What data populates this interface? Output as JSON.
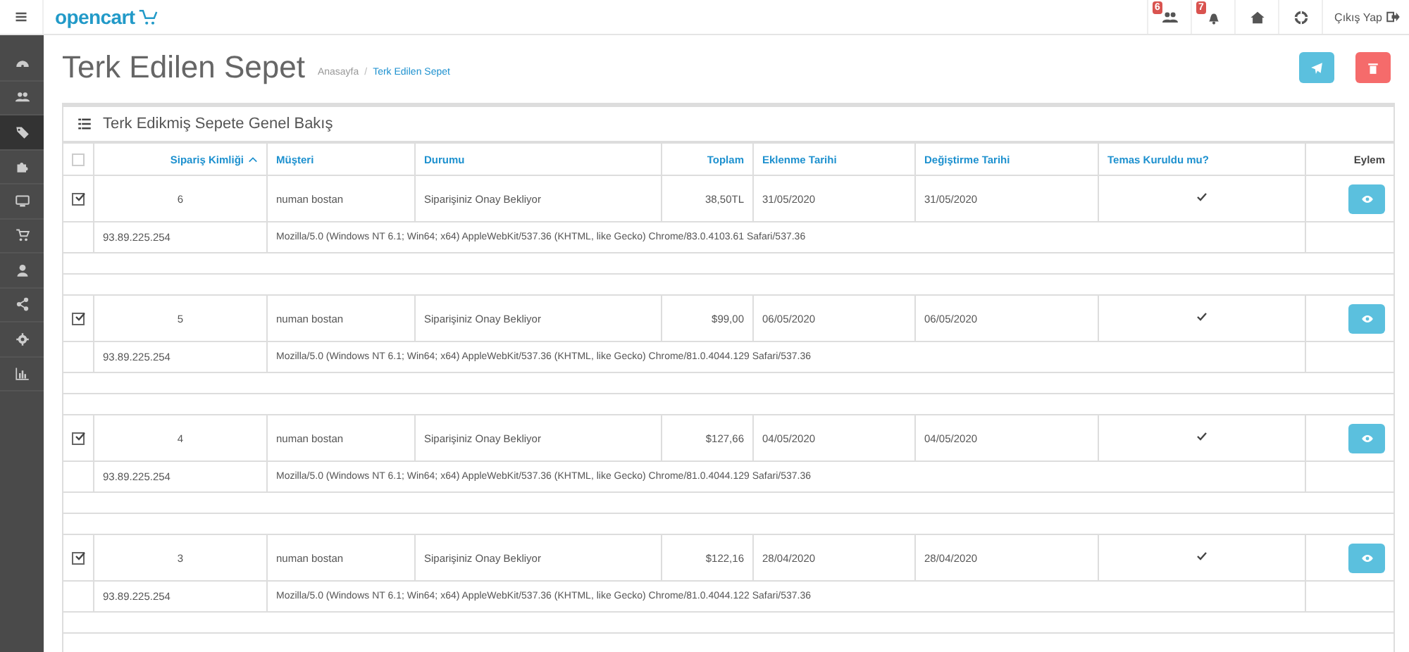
{
  "header": {
    "logo": "opencart",
    "notifications": [
      {
        "kind": "users",
        "count": "6"
      },
      {
        "kind": "bell",
        "count": "7"
      },
      {
        "kind": "home"
      },
      {
        "kind": "help"
      }
    ],
    "logout": "Çıkış Yap"
  },
  "sidebar": {
    "items": [
      {
        "selected": false
      },
      {
        "selected": false
      },
      {
        "selected": true
      },
      {
        "selected": false
      },
      {
        "selected": false
      },
      {
        "selected": false
      },
      {
        "selected": false
      },
      {
        "selected": false
      },
      {
        "selected": false
      },
      {
        "selected": false
      }
    ]
  },
  "page": {
    "title": "Terk Edilen Sepet",
    "breadcrumb_separator": "/",
    "breadcrumbs": [
      {
        "label": "Anasayfa",
        "selected": false
      },
      {
        "label": "Terk Edilen Sepet",
        "selected": true
      }
    ]
  },
  "panel": {
    "title": "Terk Edikmiş Sepete Genel Bakış"
  },
  "table": {
    "select_all": false,
    "columns": [
      {
        "label": "Sipariş Kimliği",
        "sorted": true
      },
      {
        "label": "Müşteri",
        "sorted": false
      },
      {
        "label": "Durumu",
        "sorted": false
      },
      {
        "label": "Toplam",
        "sorted": false
      },
      {
        "label": "Eklenme Tarihi",
        "sorted": false
      },
      {
        "label": "Değiştirme Tarihi",
        "sorted": false
      },
      {
        "label": "Temas Kuruldu mu?",
        "sorted": false
      },
      {
        "label": "Eylem",
        "sorted": false
      }
    ],
    "rows": [
      {
        "checked": true,
        "id": "6",
        "customer": "numan bostan",
        "status": "Siparişiniz Onay Bekliyor",
        "total": "38,50TL",
        "date_added": "31/05/2020",
        "date_modified": "31/05/2020",
        "contacted": true,
        "ip": "93.89.225.254",
        "user_agent": "Mozilla/5.0 (Windows NT 6.1; Win64; x64) AppleWebKit/537.36 (KHTML, like Gecko) Chrome/83.0.4103.61 Safari/537.36"
      },
      {
        "checked": true,
        "id": "5",
        "customer": "numan bostan",
        "status": "Siparişiniz Onay Bekliyor",
        "total": "$99,00",
        "date_added": "06/05/2020",
        "date_modified": "06/05/2020",
        "contacted": true,
        "ip": "93.89.225.254",
        "user_agent": "Mozilla/5.0 (Windows NT 6.1; Win64; x64) AppleWebKit/537.36 (KHTML, like Gecko) Chrome/81.0.4044.129 Safari/537.36"
      },
      {
        "checked": true,
        "id": "4",
        "customer": "numan bostan",
        "status": "Siparişiniz Onay Bekliyor",
        "total": "$127,66",
        "date_added": "04/05/2020",
        "date_modified": "04/05/2020",
        "contacted": true,
        "ip": "93.89.225.254",
        "user_agent": "Mozilla/5.0 (Windows NT 6.1; Win64; x64) AppleWebKit/537.36 (KHTML, like Gecko) Chrome/81.0.4044.129 Safari/537.36"
      },
      {
        "checked": true,
        "id": "3",
        "customer": "numan bostan",
        "status": "Siparişiniz Onay Bekliyor",
        "total": "$122,16",
        "date_added": "28/04/2020",
        "date_modified": "28/04/2020",
        "contacted": true,
        "ip": "93.89.225.254",
        "user_agent": "Mozilla/5.0 (Windows NT 6.1; Win64; x64) AppleWebKit/537.36 (KHTML, like Gecko) Chrome/81.0.4044.122 Safari/537.36"
      }
    ]
  }
}
